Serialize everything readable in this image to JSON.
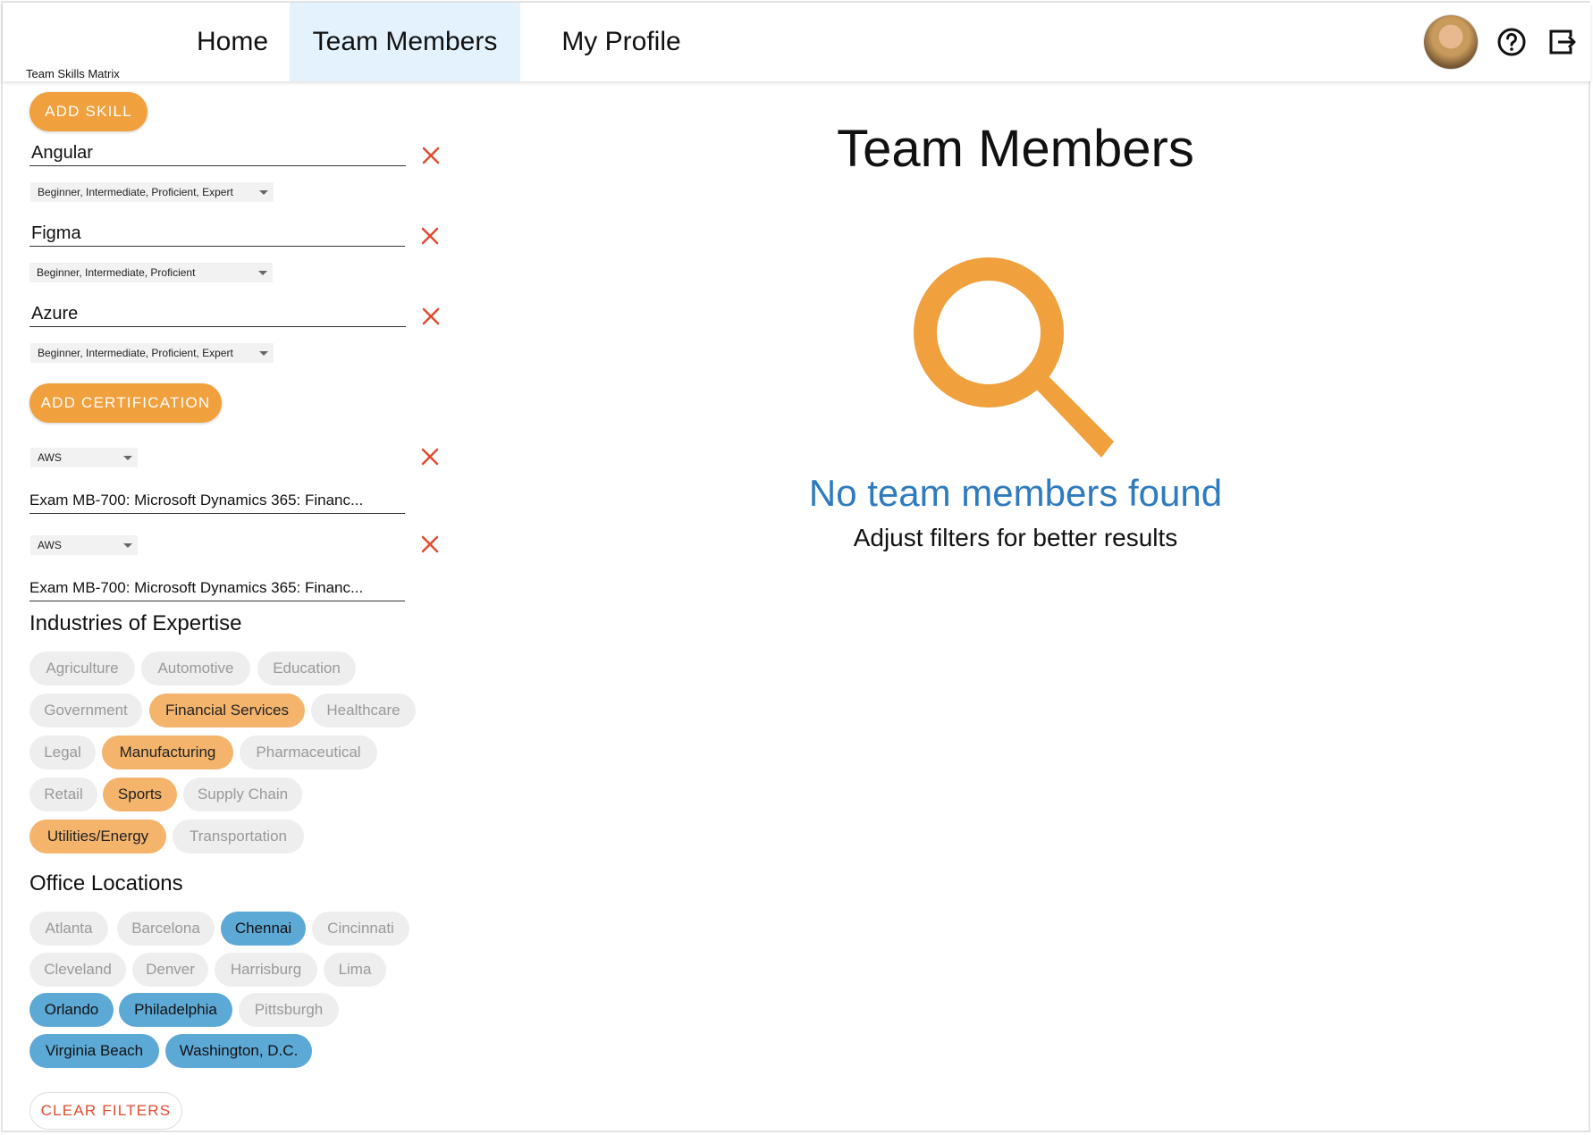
{
  "app": {
    "title": "Team Skills Matrix"
  },
  "nav": {
    "tabs": [
      {
        "label": "Home"
      },
      {
        "label": "Team Members"
      },
      {
        "label": "My Profile"
      }
    ]
  },
  "header_icons": {
    "avatar": "user-avatar",
    "help": "help-circle-icon",
    "logout": "logout-icon"
  },
  "colors": {
    "accent": "#f0a03c",
    "industry_selected": "#f4b46c",
    "location_selected": "#5da9d6",
    "empty_title": "#2e7bbf",
    "remove": "#e04a2f"
  },
  "filters": {
    "add_skill_label": "ADD SKILL",
    "skills": [
      {
        "name": "Angular",
        "levels": "Beginner, Intermediate, Proficient, Expert"
      },
      {
        "name": "Figma",
        "levels": "Beginner, Intermediate, Proficient"
      },
      {
        "name": "Azure",
        "levels": "Beginner, Intermediate, Proficient, Expert"
      }
    ],
    "add_certification_label": "ADD CERTIFICATION",
    "certifications": [
      {
        "provider": "AWS",
        "exam": "Exam MB-700: Microsoft Dynamics 365: Financ..."
      },
      {
        "provider": "AWS",
        "exam": "Exam MB-700: Microsoft Dynamics 365: Financ..."
      }
    ],
    "industries_title": "Industries of Expertise",
    "industries": [
      {
        "label": "Agriculture",
        "selected": false
      },
      {
        "label": "Automotive",
        "selected": false
      },
      {
        "label": "Education",
        "selected": false
      },
      {
        "label": "Government",
        "selected": false
      },
      {
        "label": "Financial Services",
        "selected": true
      },
      {
        "label": "Healthcare",
        "selected": false
      },
      {
        "label": "Legal",
        "selected": false
      },
      {
        "label": "Manufacturing",
        "selected": true
      },
      {
        "label": "Pharmaceutical",
        "selected": false
      },
      {
        "label": "Retail",
        "selected": false
      },
      {
        "label": "Sports",
        "selected": true
      },
      {
        "label": "Supply Chain",
        "selected": false
      },
      {
        "label": "Utilities/Energy",
        "selected": true
      },
      {
        "label": "Transportation",
        "selected": false
      }
    ],
    "locations_title": "Office Locations",
    "locations": [
      {
        "label": "Atlanta",
        "selected": false
      },
      {
        "label": "Barcelona",
        "selected": false
      },
      {
        "label": "Chennai",
        "selected": true
      },
      {
        "label": "Cincinnati",
        "selected": false
      },
      {
        "label": "Cleveland",
        "selected": false
      },
      {
        "label": "Denver",
        "selected": false
      },
      {
        "label": "Harrisburg",
        "selected": false
      },
      {
        "label": "Lima",
        "selected": false
      },
      {
        "label": "Orlando",
        "selected": true
      },
      {
        "label": "Philadelphia",
        "selected": true
      },
      {
        "label": "Pittsburgh",
        "selected": false
      },
      {
        "label": "Virginia Beach",
        "selected": true
      },
      {
        "label": "Washington, D.C.",
        "selected": true
      }
    ],
    "clear_label": "CLEAR FILTERS"
  },
  "main": {
    "title": "Team Members",
    "empty_icon": "search-icon",
    "empty_title": "No team members found",
    "empty_subtitle": "Adjust filters for better results"
  }
}
